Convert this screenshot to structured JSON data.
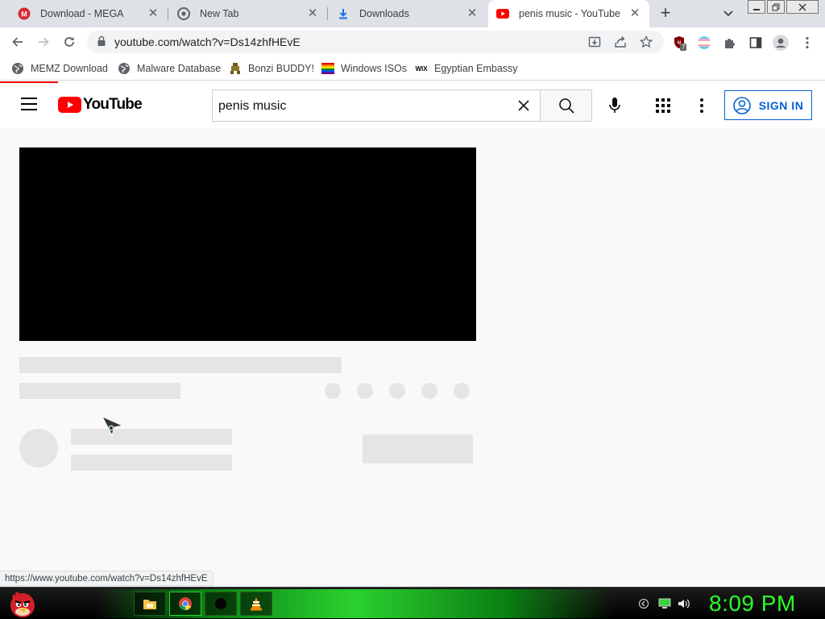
{
  "tabs": [
    {
      "title": "Download - MEGA",
      "favicon": "mega-icon",
      "active": false
    },
    {
      "title": "New Tab",
      "favicon": "chrome-icon",
      "active": false
    },
    {
      "title": "Downloads",
      "favicon": "download-icon",
      "active": false
    },
    {
      "title": "penis music - YouTube",
      "favicon": "youtube-icon",
      "active": true
    }
  ],
  "address_bar": {
    "url": "youtube.com/watch?v=Ds14zhfHEvE"
  },
  "extensions": {
    "ublock_badge": "7"
  },
  "bookmarks": [
    {
      "label": "MEMZ Download",
      "icon": "globe-icon"
    },
    {
      "label": "Malware Database",
      "icon": "globe-icon"
    },
    {
      "label": "Bonzi BUDDY!",
      "icon": "bonzi-icon"
    },
    {
      "label": "Windows ISOs",
      "icon": "rainbow-flag-icon"
    },
    {
      "label": "Egyptian Embassy",
      "icon": "wix-icon"
    }
  ],
  "youtube": {
    "logo_text": "YouTube",
    "search_query": "penis music",
    "sign_in_label": "SIGN IN"
  },
  "status_bar": {
    "link_url": "https://www.youtube.com/watch?v=Ds14zhfHEvE"
  },
  "taskbar": {
    "clock": "8:09 PM",
    "apps": [
      "file-explorer-icon",
      "chrome-icon",
      "dark-app-icon",
      "vlc-icon"
    ]
  },
  "colors": {
    "youtube_red": "#ff0000",
    "signin_blue": "#065fd4",
    "clock_green": "#2aff2a",
    "placeholder_gray": "#e5e5e5"
  }
}
